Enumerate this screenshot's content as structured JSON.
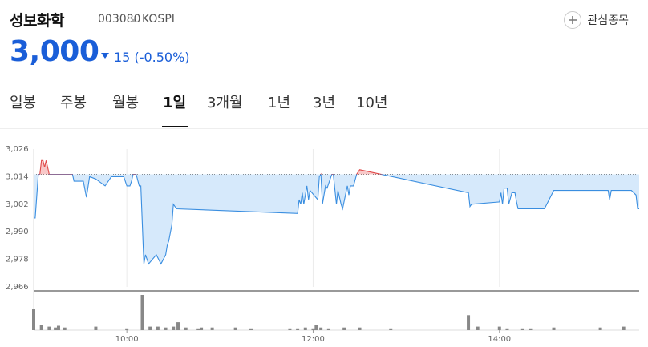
{
  "stock": {
    "name": "성보화학",
    "code": "003080",
    "market": "KOSPI",
    "price": "3,000",
    "change": "15",
    "change_pct": "(-0.50%)",
    "direction": "down"
  },
  "favorite": {
    "label": "관심종목",
    "icon": "plus-circle-icon"
  },
  "tabs": [
    {
      "label": "일봉",
      "active": false
    },
    {
      "label": "주봉",
      "active": false
    },
    {
      "label": "월봉",
      "active": false
    },
    {
      "label": "1일",
      "active": true
    },
    {
      "label": "3개월",
      "active": false
    },
    {
      "label": "1년",
      "active": false
    },
    {
      "label": "3년",
      "active": false
    },
    {
      "label": "10년",
      "active": false
    }
  ],
  "colors": {
    "accent_down": "#1a5ed8",
    "line": "#3a8ee0",
    "fill_below": "#d6e9fb",
    "line_up": "#e04a4a",
    "fill_above": "#f8c8c8",
    "volume": "#888888"
  },
  "chart_data": {
    "type": "line",
    "title": "",
    "xlabel": "",
    "ylabel": "",
    "reference_price": 3015,
    "ylim": [
      2966,
      3026
    ],
    "y_ticks": [
      "3,026",
      "3,014",
      "3,002",
      "2,990",
      "2,978",
      "2,966"
    ],
    "x_ticks": [
      "10:00",
      "12:00",
      "14:00"
    ],
    "x_range": [
      "09:00",
      "15:30"
    ],
    "series": [
      {
        "x": [
          "09:00",
          "09:01",
          "09:03",
          "09:04",
          "09:05",
          "09:06",
          "09:07",
          "09:08",
          "09:10",
          "09:14",
          "09:15",
          "09:16",
          "09:17",
          "09:18",
          "09:19",
          "09:22",
          "09:25",
          "09:26",
          "09:32",
          "09:34",
          "09:36",
          "09:40",
          "09:46",
          "09:50",
          "09:56",
          "09:58",
          "10:00",
          "10:02",
          "10:03",
          "10:04",
          "10:06",
          "10:08",
          "10:09",
          "10:11",
          "10:12",
          "10:14",
          "10:19",
          "10:22",
          "10:25",
          "10:26",
          "10:27",
          "10:29",
          "10:30",
          "10:32",
          "11:50",
          "11:51",
          "11:52",
          "11:53",
          "11:54",
          "11:56",
          "11:57",
          "11:58",
          "12:03",
          "12:04",
          "12:05",
          "12:06",
          "12:08",
          "12:09",
          "12:12",
          "12:13",
          "12:15",
          "12:16",
          "12:18",
          "12:19",
          "12:22",
          "12:23",
          "12:24",
          "12:26",
          "12:28",
          "12:30",
          "13:40",
          "13:41",
          "13:42",
          "14:00",
          "14:01",
          "14:02",
          "14:03",
          "14:05",
          "14:06",
          "14:08",
          "14:10",
          "14:11",
          "14:12",
          "14:15",
          "14:26",
          "14:29",
          "14:35",
          "14:52",
          "15:00",
          "15:10",
          "15:11",
          "15:12",
          "15:25",
          "15:28",
          "15:29",
          "15:30"
        ],
        "y": [
          2996,
          2996,
          3015,
          3015,
          3021,
          3021,
          3018,
          3021,
          3015,
          3015,
          3015,
          3015,
          3015,
          3015,
          3015,
          3015,
          3015,
          3012,
          3012,
          3005,
          3014,
          3013,
          3010,
          3014,
          3014,
          3014,
          3010,
          3010,
          3012,
          3015,
          3015,
          3010,
          3010,
          2976,
          2980,
          2976,
          2980,
          2976,
          2980,
          2984,
          2986,
          2993,
          3002,
          3000,
          2998,
          3004,
          3002,
          3007,
          3002,
          3010,
          3004,
          3008,
          3004,
          3014,
          3015,
          3002,
          3010,
          3009,
          3015,
          3015,
          3002,
          3008,
          3002,
          3000,
          3010,
          3006,
          3010,
          3010,
          3015,
          3017,
          3007,
          3001,
          3002,
          3003,
          3007,
          3002,
          3009,
          3009,
          3002,
          3007,
          3007,
          3003,
          3000,
          3000,
          3000,
          3000,
          3008,
          3008,
          3008,
          3008,
          3004,
          3008,
          3008,
          3006,
          3000,
          3000
        ]
      }
    ],
    "volume": {
      "x": [
        "09:00",
        "09:05",
        "09:10",
        "09:14",
        "09:16",
        "09:20",
        "09:40",
        "10:00",
        "10:10",
        "10:15",
        "10:20",
        "10:25",
        "10:30",
        "10:33",
        "10:38",
        "10:46",
        "10:48",
        "10:55",
        "11:10",
        "11:20",
        "11:45",
        "11:50",
        "11:55",
        "12:00",
        "12:02",
        "12:05",
        "12:10",
        "12:20",
        "12:30",
        "12:50",
        "13:40",
        "13:46",
        "14:00",
        "14:05",
        "14:15",
        "14:20",
        "14:35",
        "15:05",
        "15:20"
      ],
      "values": [
        24,
        6,
        4,
        3,
        5,
        3,
        4,
        2,
        40,
        4,
        4,
        3,
        4,
        9,
        3,
        2,
        3,
        3,
        3,
        2,
        2,
        2,
        3,
        2,
        6,
        3,
        2,
        3,
        3,
        2,
        17,
        4,
        4,
        2,
        2,
        2,
        3,
        3,
        4
      ]
    }
  }
}
